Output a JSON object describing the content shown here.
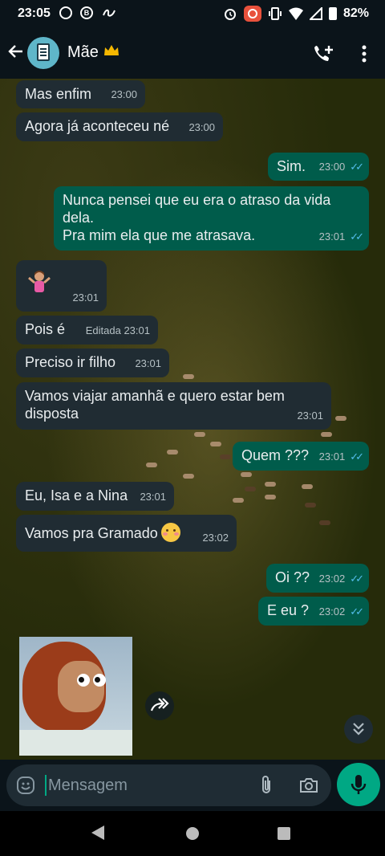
{
  "status_bar": {
    "time": "23:05",
    "battery": "82%"
  },
  "header": {
    "contact_name": "Mãe",
    "contact_emoji": "crown"
  },
  "messages": [
    {
      "dir": "in",
      "text": "Mas enfim",
      "time": "23:00"
    },
    {
      "dir": "in",
      "text": "Agora já aconteceu né",
      "time": "23:00"
    },
    {
      "dir": "out",
      "text": "Sim.",
      "time": "23:00"
    },
    {
      "dir": "out",
      "text": "Nunca pensei que eu era o atraso da vida\ndela.\nPra mim ela que me atrasava.",
      "time": "23:01"
    },
    {
      "dir": "in",
      "text": "",
      "emoji": "woman-shrugging",
      "time": "23:01"
    },
    {
      "dir": "in",
      "text": "Pois é",
      "edited_label": "Editada",
      "time": "23:01"
    },
    {
      "dir": "in",
      "text": "Preciso ir filho",
      "time": "23:01"
    },
    {
      "dir": "in",
      "text": "Vamos viajar amanhã e quero estar bem\ndisposta",
      "time": "23:01"
    },
    {
      "dir": "out",
      "text": "Quem ???",
      "time": "23:01"
    },
    {
      "dir": "in",
      "text": "Eu, Isa e a Nina",
      "time": "23:01"
    },
    {
      "dir": "in",
      "text": "Vamos pra Gramado",
      "emoji": "smiling-face-with-hearts",
      "time": "23:02"
    },
    {
      "dir": "out",
      "text": "Oi ??",
      "time": "23:02"
    },
    {
      "dir": "out",
      "text": "E eu ?",
      "time": "23:02"
    }
  ],
  "sticker": {
    "description_icon": "monkey-puppet-sticker"
  },
  "composer": {
    "placeholder": "Mensagem"
  },
  "colors": {
    "incoming": "#202c33",
    "outgoing": "#005c4b",
    "accent": "#00a884",
    "read_ticks": "#53bdeb"
  }
}
